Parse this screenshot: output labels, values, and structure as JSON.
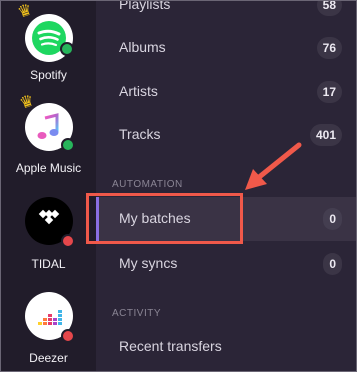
{
  "services": [
    {
      "name": "Spotify",
      "icon": "spotify-icon",
      "status": "connected",
      "status_color": "#27b55b"
    },
    {
      "name": "Apple Music",
      "icon": "apple-music-icon",
      "status": "connected",
      "status_color": "#27b55b"
    },
    {
      "name": "TIDAL",
      "icon": "tidal-icon",
      "status": "disconnected",
      "status_color": "#e5474b"
    },
    {
      "name": "Deezer",
      "icon": "deezer-icon",
      "status": "disconnected",
      "status_color": "#e5474b"
    }
  ],
  "library": [
    {
      "label": "Playlists",
      "count": "58"
    },
    {
      "label": "Albums",
      "count": "76"
    },
    {
      "label": "Artists",
      "count": "17"
    },
    {
      "label": "Tracks",
      "count": "401"
    }
  ],
  "automation": {
    "header": "AUTOMATION",
    "items": [
      {
        "label": "My batches",
        "count": "0"
      },
      {
        "label": "My syncs",
        "count": "0"
      }
    ]
  },
  "activity": {
    "header": "ACTIVITY",
    "items": [
      {
        "label": "Recent transfers"
      }
    ]
  },
  "colors": {
    "accent": "#8b6fe3",
    "annotation": "#f0594a",
    "crown": "#f2c21b"
  }
}
